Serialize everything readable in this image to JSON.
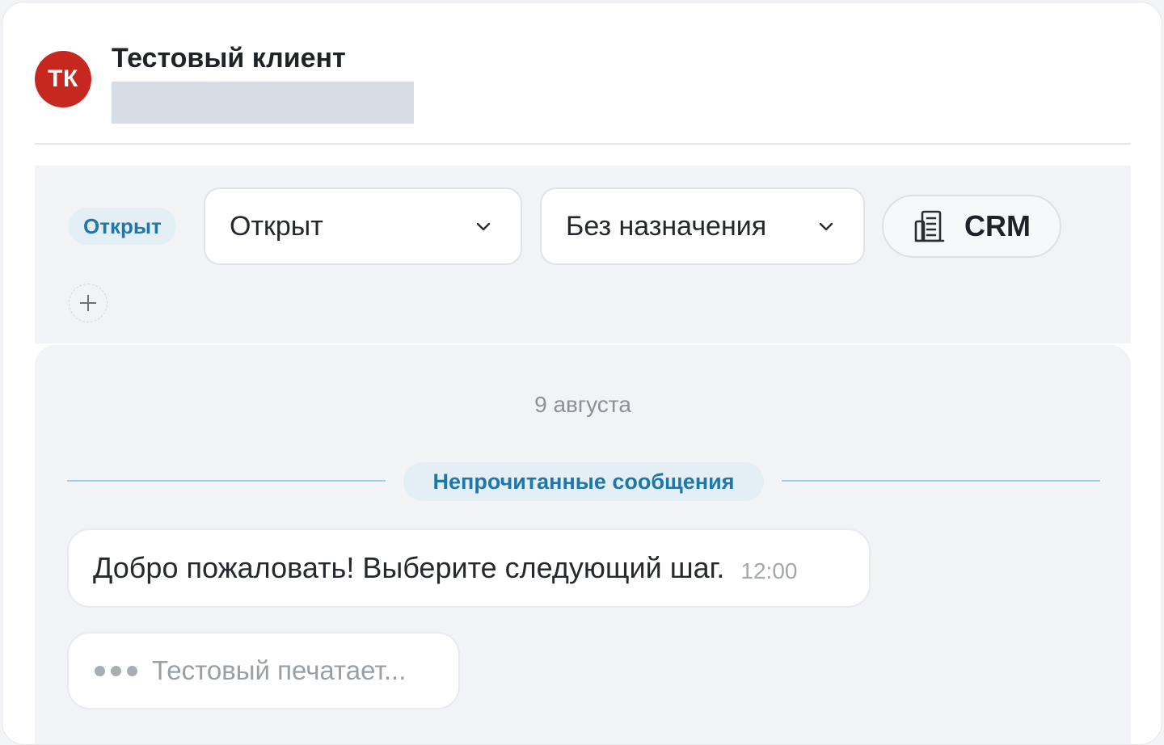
{
  "header": {
    "avatar_initials": "ТК",
    "client_name": "Тестовый клиент"
  },
  "toolbar": {
    "status_badge": "Открыт",
    "status_select": "Открыт",
    "assignee_select": "Без назначения",
    "crm_label": "CRM",
    "add_icon": "plus-icon"
  },
  "chat": {
    "date_divider": "9 августа",
    "unread_label": "Непрочитанные сообщения",
    "messages": [
      {
        "text": "Добро пожаловать! Выберите следующий шаг.",
        "time": "12:00"
      }
    ],
    "typing_text": "Тестовый печатает..."
  },
  "colors": {
    "avatar_bg": "#c6271f",
    "accent": "#1d77a8",
    "badge_bg": "#e4eef5",
    "panel_bg": "#f1f3f6"
  }
}
